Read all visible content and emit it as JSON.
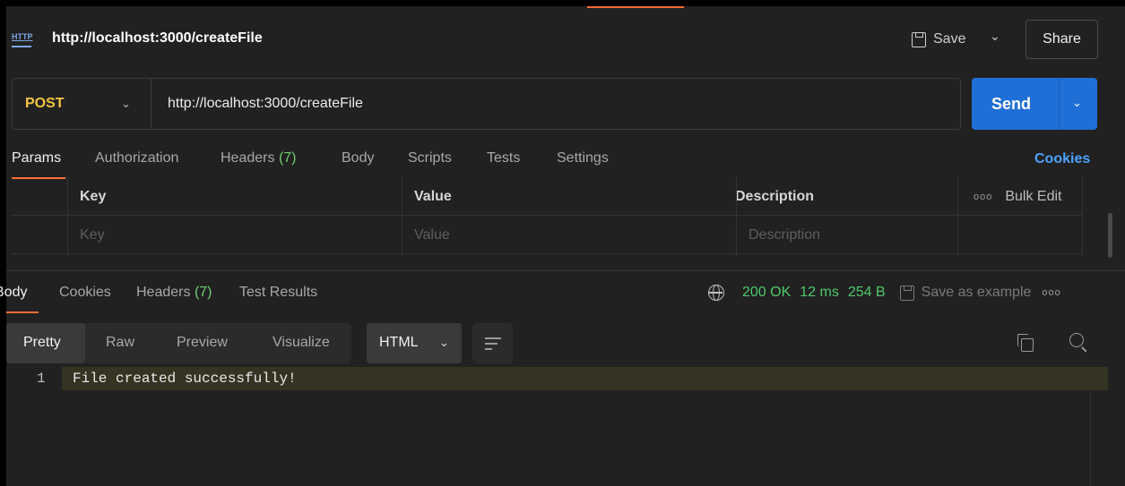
{
  "request": {
    "title": "http://localhost:3000/createFile",
    "icon": "http-icon",
    "icon_text": "HTTP",
    "method": "POST",
    "url": "http://localhost:3000/createFile"
  },
  "header_actions": {
    "save_label": "Save",
    "share_label": "Share",
    "send_label": "Send"
  },
  "request_tabs": {
    "params": "Params",
    "authorization": "Authorization",
    "headers": "Headers",
    "headers_count": "(7)",
    "body": "Body",
    "scripts": "Scripts",
    "tests": "Tests",
    "settings": "Settings",
    "cookies": "Cookies"
  },
  "params_table": {
    "headers": {
      "key": "Key",
      "value": "Value",
      "description": "Description",
      "bulk_edit": "Bulk Edit",
      "more": "ooo"
    },
    "placeholders": {
      "key": "Key",
      "value": "Value",
      "description": "Description"
    }
  },
  "response_tabs": {
    "body": "Body",
    "cookies": "Cookies",
    "headers": "Headers",
    "headers_count": "(7)",
    "test_results": "Test Results"
  },
  "response_status": {
    "status": "200 OK",
    "time": "12 ms",
    "size": "254 B",
    "save_example": "Save as example",
    "more": "ooo"
  },
  "view_modes": {
    "pretty": "Pretty",
    "raw": "Raw",
    "preview": "Preview",
    "visualize": "Visualize",
    "language": "HTML"
  },
  "response_body": {
    "line_number": "1",
    "line_text": "File created successfully!"
  },
  "colors": {
    "accent": "#ff6c37",
    "send": "#1f6fd6",
    "method": "#f5c542",
    "status_ok": "#4fc96b",
    "link": "#4da3ff"
  }
}
